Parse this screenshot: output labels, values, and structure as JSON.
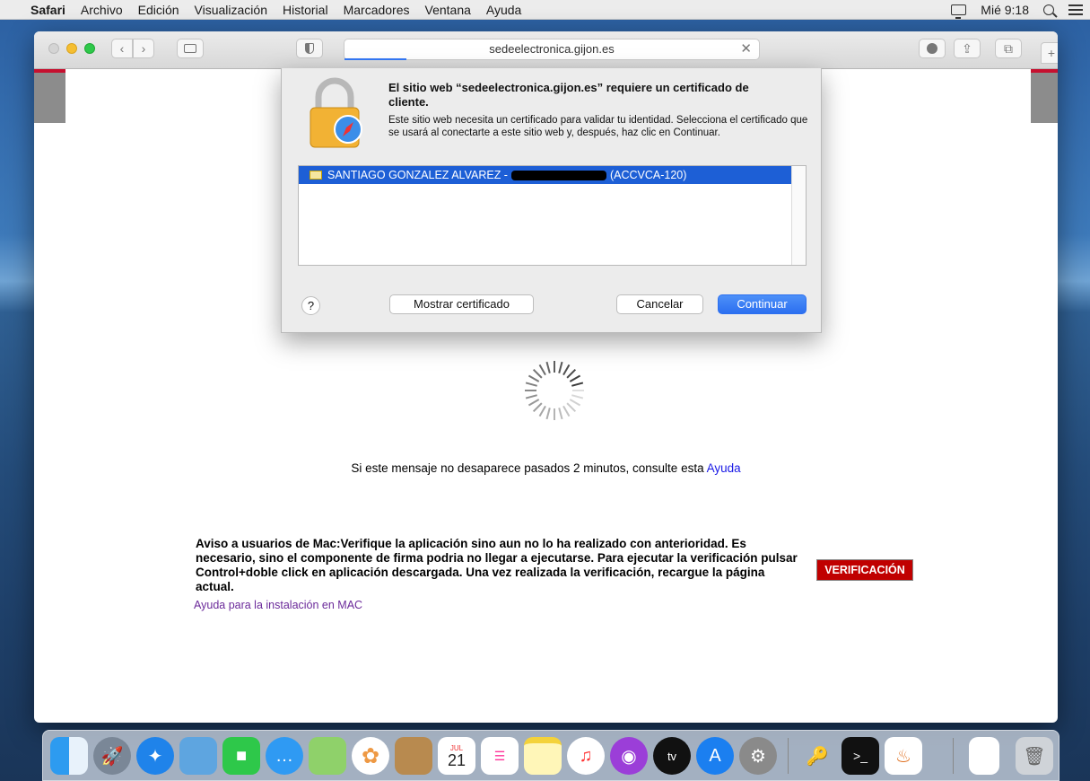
{
  "menubar": {
    "app": "Safari",
    "items": [
      "Archivo",
      "Edición",
      "Visualización",
      "Historial",
      "Marcadores",
      "Ventana",
      "Ayuda"
    ],
    "clock": "Mié 9:18"
  },
  "browser": {
    "url": "sedeelectronica.gijon.es",
    "load_progress": 0.15
  },
  "dialog": {
    "title": "El sitio web “sedeelectronica.gijon.es” requiere un certificado de cliente.",
    "body": "Este sitio web necesita un certificado para validar tu identidad. Selecciona el certificado que se usará al conectarte a este sitio web y, después, haz clic en Continuar.",
    "certificate_name": "SANTIAGO GONZALEZ ALVAREZ -",
    "certificate_issuer": "(ACCVCA-120)",
    "help_label": "?",
    "show_cert": "Mostrar certificado",
    "cancel": "Cancelar",
    "continue": "Continuar"
  },
  "page": {
    "wait_message": "Si este mensaje no desaparece pasados 2 minutos, consulte esta",
    "wait_link": "Ayuda",
    "mac_notice": "Aviso a usuarios de Mac:Verifique la aplicación sino aun no lo ha realizado con anterioridad. Es necesario, sino el componente de firma podria no llegar a ejecutarse. Para ejecutar la verificación pulsar Control+doble click en aplicación descargada. Una vez realizada la verificación, recargue la página actual.",
    "mac_help_link": "Ayuda para la instalación en MAC",
    "verify_button": "VERIFICACIÓN"
  },
  "dock": {
    "calendar_month": "JUL",
    "calendar_day": "21",
    "appletv_label": "tv",
    "items": [
      "finder-icon",
      "launchpad-icon",
      "safari-icon",
      "preview-icon",
      "facetime-icon",
      "messages-icon",
      "maps-icon",
      "photos-icon",
      "contacts-icon",
      "calendar-icon",
      "reminders-icon",
      "notes-icon",
      "music-icon",
      "podcasts-icon",
      "appletv-icon",
      "appstore-icon",
      "system-preferences-icon",
      "keychain-icon",
      "terminal-icon",
      "java-icon",
      "document-icon",
      "trash-icon"
    ]
  },
  "colors": {
    "accent": "#2c6ff0",
    "site_red": "#c6102f",
    "verify_red": "#c00000"
  }
}
